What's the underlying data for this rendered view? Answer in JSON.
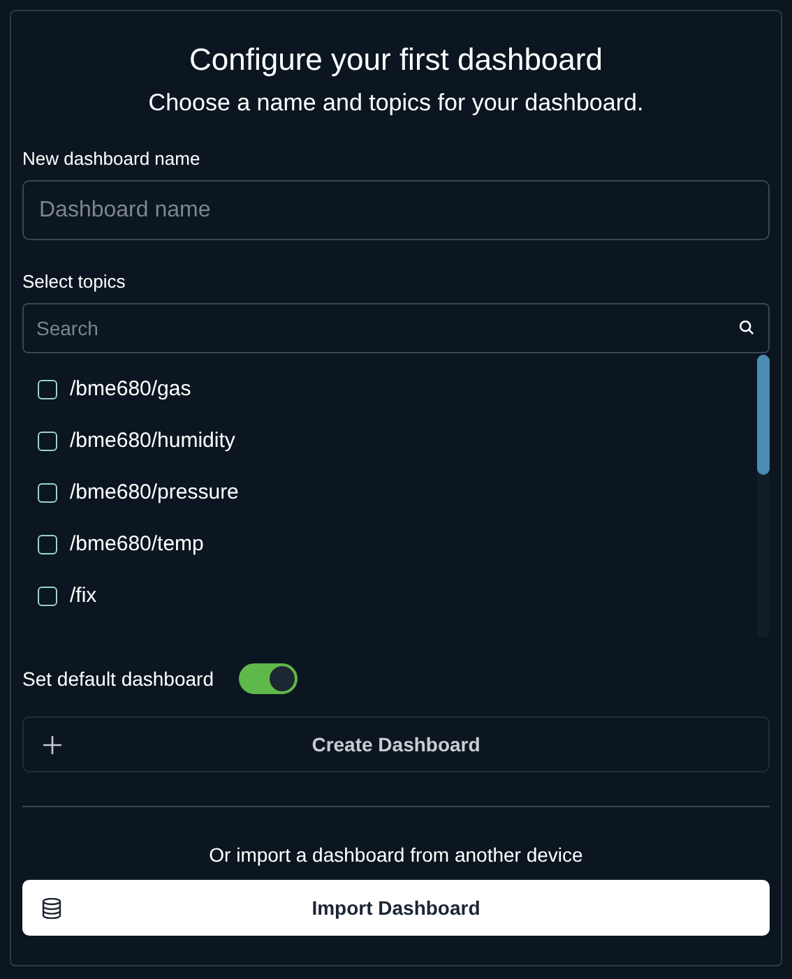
{
  "title": "Configure your first dashboard",
  "subtitle": "Choose a name and topics for your dashboard.",
  "name_field": {
    "label": "New dashboard name",
    "placeholder": "Dashboard name"
  },
  "topics": {
    "label": "Select topics",
    "search_placeholder": "Search",
    "items": [
      {
        "label": "/bme680/gas",
        "checked": false
      },
      {
        "label": "/bme680/humidity",
        "checked": false
      },
      {
        "label": "/bme680/pressure",
        "checked": false
      },
      {
        "label": "/bme680/temp",
        "checked": false
      },
      {
        "label": "/fix",
        "checked": false
      }
    ]
  },
  "default_toggle": {
    "label": "Set default dashboard",
    "on": true
  },
  "create_button": "Create Dashboard",
  "import_hint": "Or import a dashboard from another device",
  "import_button": "Import Dashboard"
}
